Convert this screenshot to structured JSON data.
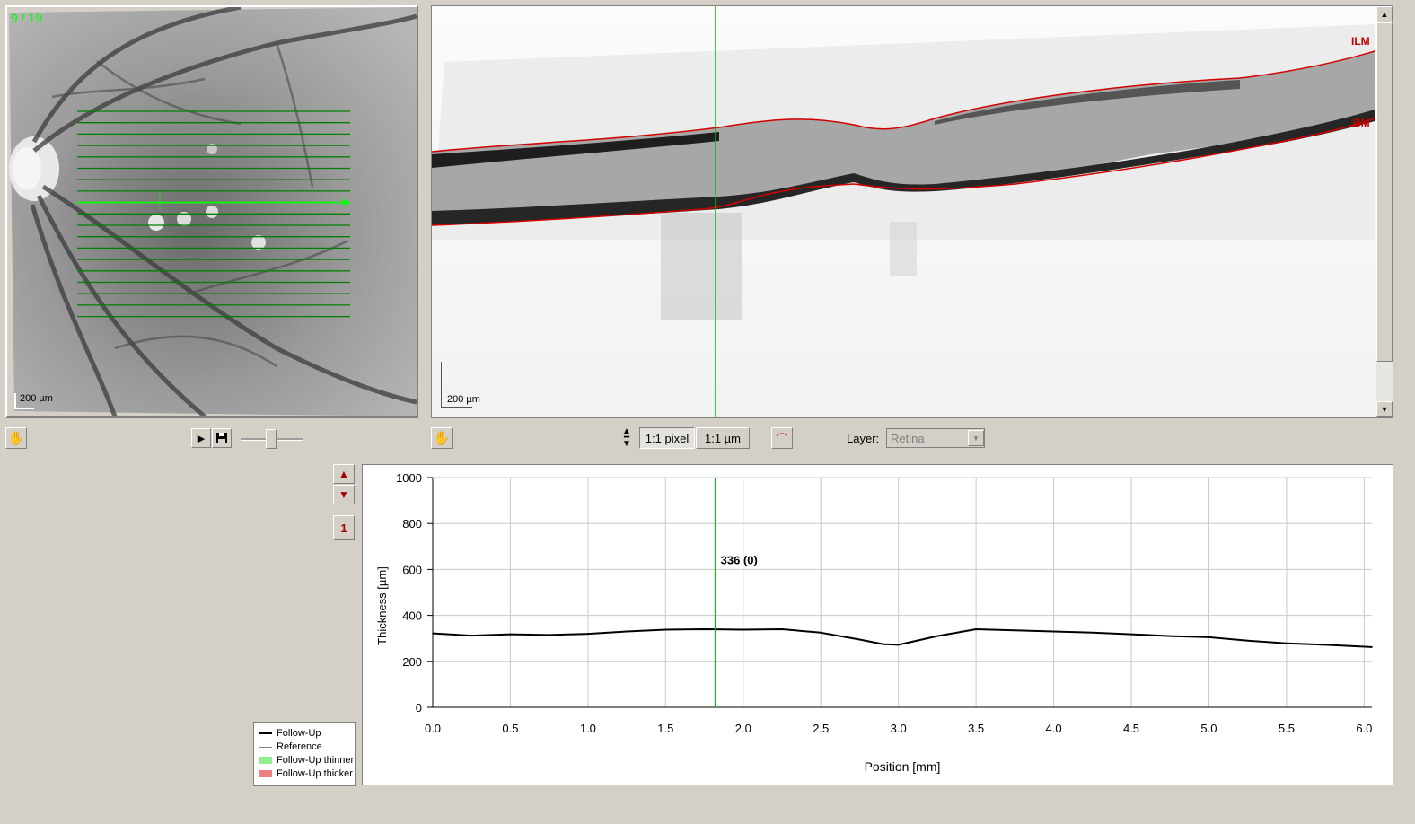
{
  "fundus": {
    "scan_counter": "9 / 19",
    "scale_label": "200 µm",
    "scan_count": 19,
    "selected_scan": 9
  },
  "bscan": {
    "ilm_label": "ILM",
    "bm_label": "BM",
    "scale_label": "200 µm"
  },
  "toolbar": {
    "zoom_1to1_pixel": "1:1 pixel",
    "zoom_1to1_um": "1:1 µm",
    "layer_label": "Layer:",
    "layer_value": "Retina"
  },
  "series_index": "1",
  "legend": {
    "follow_up": "Follow-Up",
    "reference": "Reference",
    "thinner": "Follow-Up thinner",
    "thicker": "Follow-Up thicker"
  },
  "colors": {
    "scan_line": "#008000",
    "selected_scan": "#00ff00",
    "segmentation": "#d40000",
    "thinner": "#90ee90",
    "thicker": "#f08080"
  },
  "chart_data": {
    "type": "line",
    "xlabel": "Position [mm]",
    "ylabel": "Thickness [µm]",
    "xlim": [
      0.0,
      6.05
    ],
    "ylim": [
      0,
      1000
    ],
    "xticks": [
      "0.0",
      "0.5",
      "1.0",
      "1.5",
      "2.0",
      "2.5",
      "3.0",
      "3.5",
      "4.0",
      "4.5",
      "5.0",
      "5.5",
      "6.0"
    ],
    "yticks": [
      "0",
      "200",
      "400",
      "600",
      "800",
      "1000"
    ],
    "grid": true,
    "cursor": {
      "x": 1.82,
      "label": "336 (0)"
    },
    "x": [
      0.0,
      0.25,
      0.5,
      0.75,
      1.0,
      1.25,
      1.5,
      1.75,
      2.0,
      2.25,
      2.5,
      2.75,
      2.9,
      3.0,
      3.25,
      3.5,
      3.75,
      4.0,
      4.25,
      4.5,
      4.75,
      5.0,
      5.25,
      5.5,
      5.75,
      6.05
    ],
    "series": [
      {
        "name": "Follow-Up",
        "values": [
          322,
          312,
          318,
          315,
          320,
          330,
          338,
          340,
          338,
          340,
          325,
          295,
          275,
          272,
          310,
          340,
          335,
          330,
          325,
          318,
          310,
          305,
          290,
          278,
          272,
          262
        ]
      },
      {
        "name": "Reference",
        "values": [
          322,
          312,
          318,
          315,
          320,
          330,
          338,
          340,
          338,
          340,
          325,
          295,
          275,
          272,
          310,
          340,
          335,
          330,
          325,
          318,
          310,
          305,
          290,
          278,
          272,
          262
        ]
      }
    ]
  }
}
